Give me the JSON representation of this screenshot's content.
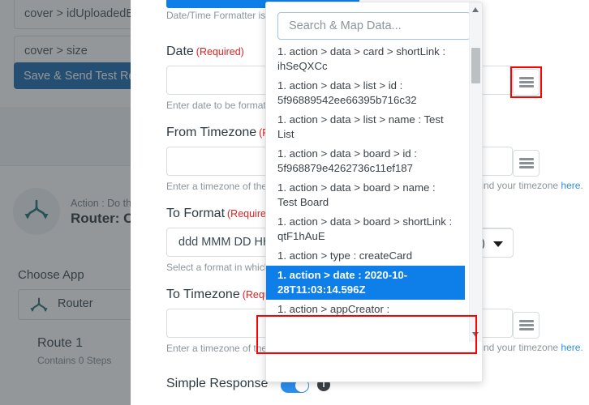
{
  "left_panel": {
    "pill_1": "cover > idUploadedBy",
    "pill_2": "cover > size",
    "save_button": "Save & Send Test Request",
    "action_kicker": "Action : Do this ...",
    "action_title": "Router: C...",
    "choose_app_label": "Choose App",
    "app_name": "Router",
    "app_icon": "router-icon",
    "route_title": "Route 1",
    "route_subtitle": "Contains 0 Steps"
  },
  "form": {
    "note": "Date/Time Formatter is a...",
    "fields": [
      {
        "label": "Date",
        "required": "(Required)",
        "value": "",
        "help": "Enter date to be formatted"
      },
      {
        "label": "From Timezone",
        "required": "(Required)",
        "value": "",
        "help": "Enter a timezone of the d..."
      },
      {
        "label": "To Format",
        "required": "(Required)",
        "value": "ddd MMM DD HH:mm",
        "help": "Select a format in which y..."
      },
      {
        "label": "To Timezone",
        "required": "(Required)",
        "value": "",
        "help": "Enter a timezone of the d..."
      }
    ],
    "help_suffix_text": "find your timezone",
    "help_link_text": "here",
    "help_suffix_period": ".",
    "burger_icon": "hamburger-menu-icon",
    "select_partial_text": ")",
    "select_caret_icon": "chevron-down-icon",
    "simple_response_label": "Simple Response",
    "simple_response_on": "true",
    "info_icon": "info-icon"
  },
  "map_panel": {
    "search_placeholder": "Search & Map Data...",
    "search_value": "",
    "scroll_up_icon": "scroll-up-arrow-icon",
    "scroll_down_icon": "scroll-down-arrow-icon",
    "items": [
      {
        "text": "1. action > data > card > shortLink : ihSeQXCc",
        "selected": false
      },
      {
        "text": "1. action > data > list > id : 5f96889542ee66395b716c32",
        "selected": false
      },
      {
        "text": "1. action > data > list > name : Test List",
        "selected": false
      },
      {
        "text": "1. action > data > board > id : 5f968879e4262736c11ef187",
        "selected": false
      },
      {
        "text": "1. action > data > board > name : Test Board",
        "selected": false
      },
      {
        "text": "1. action > data > board > shortLink : qtF1hAuE",
        "selected": false
      },
      {
        "text": "1. action > type : createCard",
        "selected": false
      },
      {
        "text": "1. action > date : 2020-10-28T11:03:14.596Z",
        "selected": true
      },
      {
        "text": "1. action > appCreator :",
        "selected": false
      }
    ]
  },
  "colors": {
    "accent_blue": "#0e7fe8",
    "save_blue": "#0b5ea8",
    "required_red": "#e02020",
    "highlight_red": "#ff0000",
    "link_blue": "#2b8ded",
    "router_teal": "#11676b"
  }
}
